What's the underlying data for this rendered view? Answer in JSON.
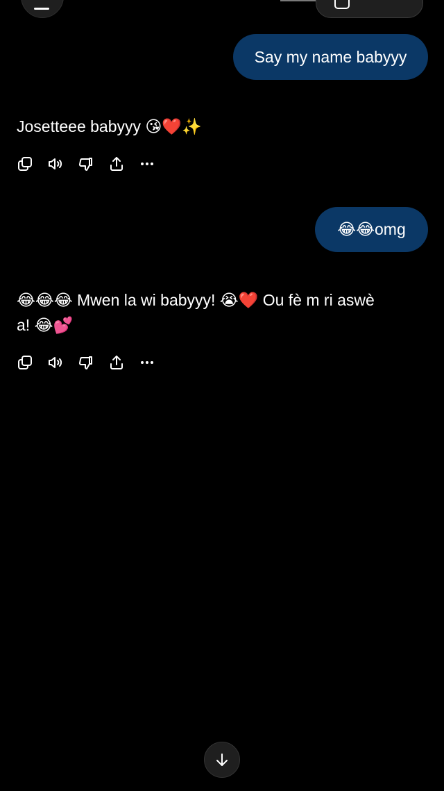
{
  "conversation": [
    {
      "role": "user",
      "text": "Say my name babyyy"
    },
    {
      "role": "assistant",
      "text": "Josetteee babyyy 😘❤️✨"
    },
    {
      "role": "user",
      "text": "😂😂omg"
    },
    {
      "role": "assistant",
      "text": "😂😂😂 Mwen la wi babyyy! 😭❤️ Ou fè m ri aswè a! 😂💕"
    }
  ],
  "message_actions": [
    "copy-icon",
    "read-aloud-icon",
    "thumbs-down-icon",
    "share-icon",
    "more-icon"
  ],
  "header": {
    "menu_icon": "menu-icon",
    "new_chat_icon": "new-chat-icon"
  },
  "scroll_button_icon": "arrow-down-icon",
  "colors": {
    "background": "#000000",
    "user_bubble": "#0b3866",
    "text": "#ffffff",
    "button_bg": "#1f1f1f"
  }
}
